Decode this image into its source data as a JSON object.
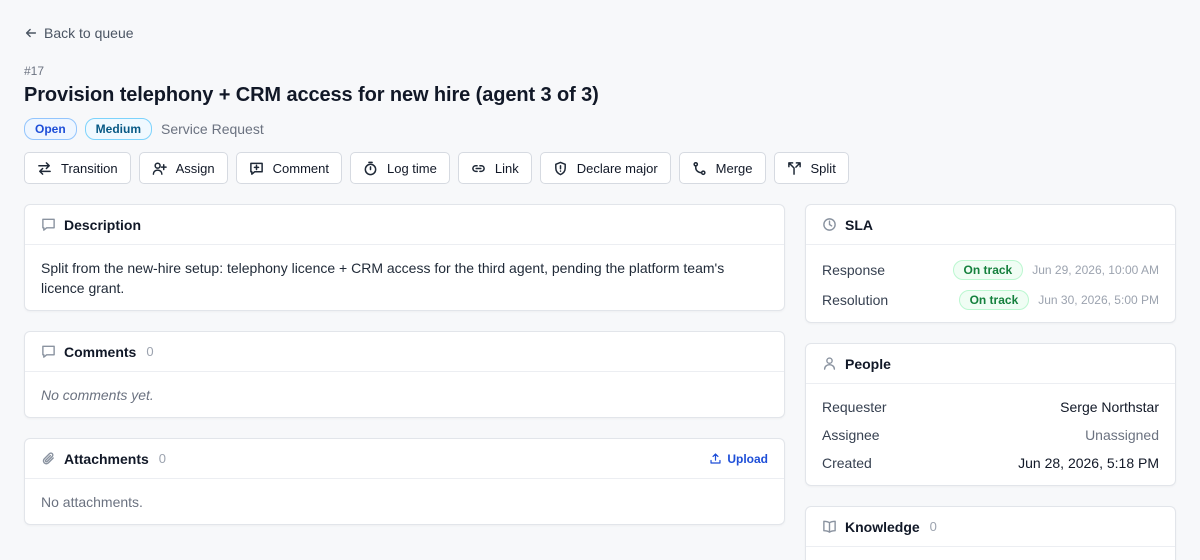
{
  "nav": {
    "back_label": "Back to queue"
  },
  "ticket": {
    "id": "#17",
    "title": "Provision telephony + CRM access for new hire (agent 3 of 3)",
    "status": "Open",
    "priority": "Medium",
    "type": "Service Request"
  },
  "toolbar": {
    "transition": "Transition",
    "assign": "Assign",
    "comment": "Comment",
    "log_time": "Log time",
    "link": "Link",
    "declare_major": "Declare major",
    "merge": "Merge",
    "split": "Split"
  },
  "description": {
    "title": "Description",
    "text": "Split from the new-hire setup: telephony licence + CRM access for the third agent, pending the platform team's licence grant."
  },
  "comments": {
    "title": "Comments",
    "count": "0",
    "empty": "No comments yet."
  },
  "attachments": {
    "title": "Attachments",
    "count": "0",
    "upload_label": "Upload",
    "empty": "No attachments."
  },
  "sla": {
    "title": "SLA",
    "rows": [
      {
        "label": "Response",
        "status": "On track",
        "time": "Jun 29, 2026, 10:00 AM"
      },
      {
        "label": "Resolution",
        "status": "On track",
        "time": "Jun 30, 2026, 5:00 PM"
      }
    ]
  },
  "people": {
    "title": "People",
    "requester_label": "Requester",
    "requester": "Serge Northstar",
    "assignee_label": "Assignee",
    "assignee": "Unassigned",
    "created_label": "Created",
    "created": "Jun 28, 2026, 5:18 PM"
  },
  "knowledge": {
    "title": "Knowledge",
    "count": "0"
  },
  "colors": {
    "accent": "#1d4ed8",
    "success": "#15803d",
    "background": "#f7f8fa"
  }
}
